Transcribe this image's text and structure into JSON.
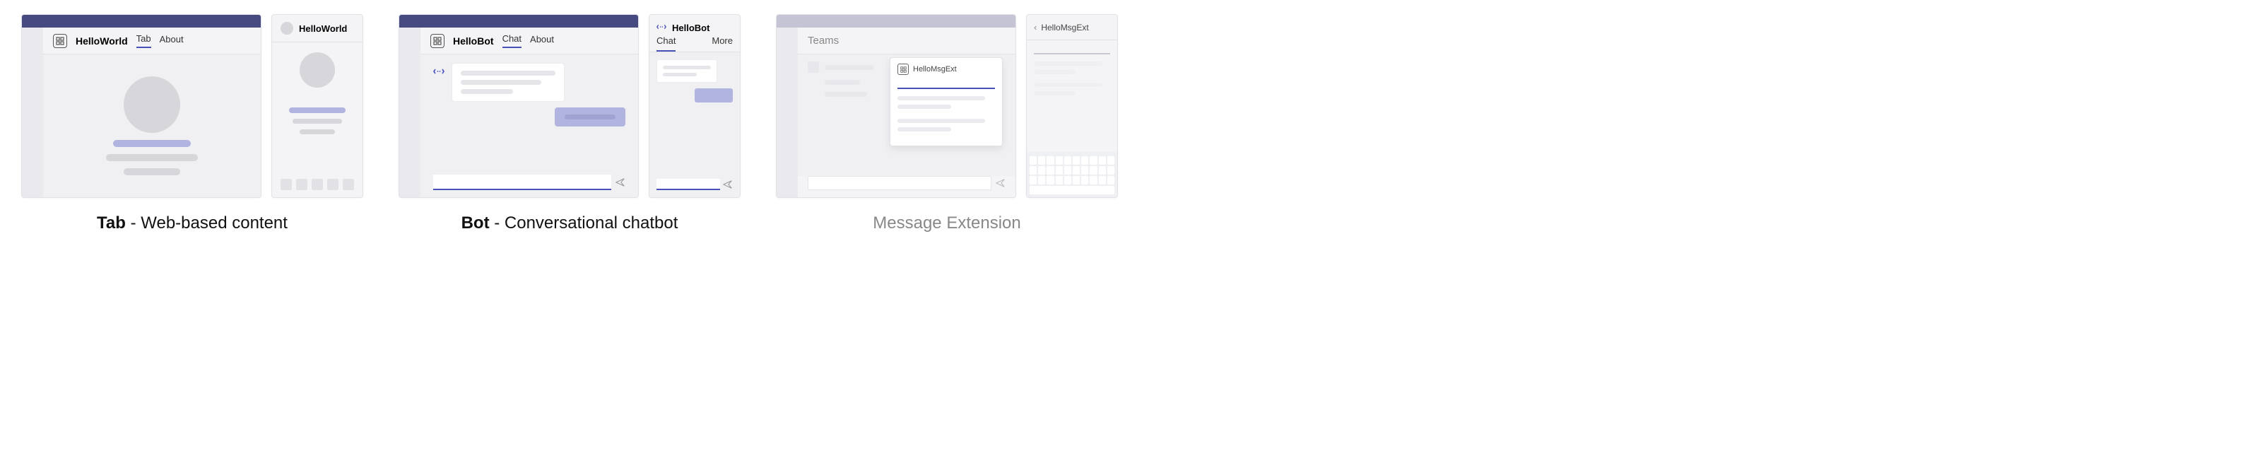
{
  "tab": {
    "app_name": "HelloWorld",
    "tabs": {
      "tab_label": "Tab",
      "about_label": "About"
    },
    "mobile_title": "HelloWorld",
    "caption_bold": "Tab",
    "caption_rest": " - Web-based content"
  },
  "bot": {
    "app_name": "HelloBot",
    "tabs": {
      "chat_label": "Chat",
      "about_label": "About"
    },
    "mobile_title": "HelloBot",
    "mobile_tabs": {
      "chat_label": "Chat",
      "more_label": "More"
    },
    "caption_bold": "Bot",
    "caption_rest": " - Conversational chatbot"
  },
  "msgext": {
    "teams_label": "Teams",
    "card_title": "HelloMsgExt",
    "mobile_title": "HelloMsgExt",
    "caption": "Message Extension"
  }
}
